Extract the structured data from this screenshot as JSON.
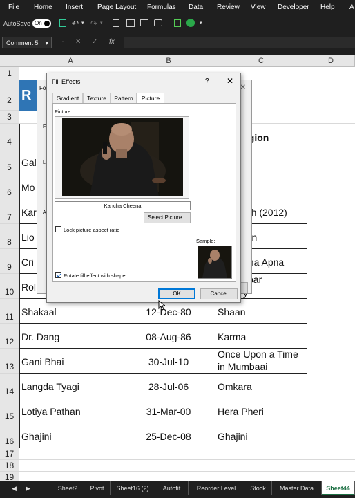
{
  "menu": [
    "File",
    "Home",
    "Insert",
    "Page Layout",
    "Formulas",
    "Data",
    "Review",
    "View",
    "Developer",
    "Help",
    "A"
  ],
  "qat": {
    "autosave_label": "AutoSave",
    "toggle_label": "On"
  },
  "formula_bar": {
    "name_box": "Comment 5",
    "fx": "fx"
  },
  "columns": [
    "A",
    "B",
    "C",
    "D"
  ],
  "rows": [
    "1",
    "2",
    "3",
    "4",
    "5",
    "6",
    "7",
    "8",
    "9",
    "10",
    "11",
    "12",
    "13",
    "14",
    "15",
    "16",
    "17",
    "18",
    "19"
  ],
  "behind": {
    "r2_a": "R",
    "r4_c": "egion",
    "r5_a": "Gal",
    "r6_a": "Mo",
    "r6_c": "a",
    "r7_a": "Kar",
    "r7_c": "ath (2012)",
    "r8_a": "Lio",
    "r8_c": "ran",
    "r9_a": "Cri",
    "r9_c": "pna Apna",
    "r10_a": "Rol",
    "r10_c1": "kbar",
    "r10_c2": "y"
  },
  "table": [
    {
      "row": "11",
      "name": "Shakaal",
      "date": "12-Dec-80",
      "film": "Shaan"
    },
    {
      "row": "12",
      "name": "Dr. Dang",
      "date": "08-Aug-86",
      "film": "Karma"
    },
    {
      "row": "13",
      "name": "Gani Bhai",
      "date": "30-Jul-10",
      "film1": "Once Upon a Time",
      "film2": "in Mumbaai"
    },
    {
      "row": "14",
      "name": "Langda Tyagi",
      "date": "28-Jul-06",
      "film": "Omkara"
    },
    {
      "row": "15",
      "name": "Lotiya Pathan",
      "date": "31-Mar-00",
      "film": "Hera Pheri"
    },
    {
      "row": "16",
      "name": "Ghajini",
      "date": "25-Dec-08",
      "film": "Ghajini"
    }
  ],
  "back_dialog": {
    "title": "Fo",
    "l1": "Fi",
    "l2": "Li",
    "l3": "A"
  },
  "dialog": {
    "title": "Fill Effects",
    "help": "?",
    "close": "✕",
    "tabs": [
      "Gradient",
      "Texture",
      "Pattern",
      "Picture"
    ],
    "picture_label": "Picture:",
    "file_name": "Kancha Cheena",
    "select_button": "Select Picture...",
    "lock_label": "Lock picture aspect ratio",
    "sample_label": "Sample:",
    "rotate_label": "Rotate fill effect with shape",
    "ok": "OK",
    "cancel": "Cancel"
  },
  "sheets": [
    "...",
    "Sheet2",
    "Pivot",
    "Sheet16 (2)",
    "Autofit",
    "Reorder Level",
    "Stock",
    "Master Data",
    "Sheet44"
  ],
  "colors": {
    "active_sheet": "#1e7145",
    "dark_bg": "#1f1f1f",
    "ok_border": "#0078d7"
  }
}
